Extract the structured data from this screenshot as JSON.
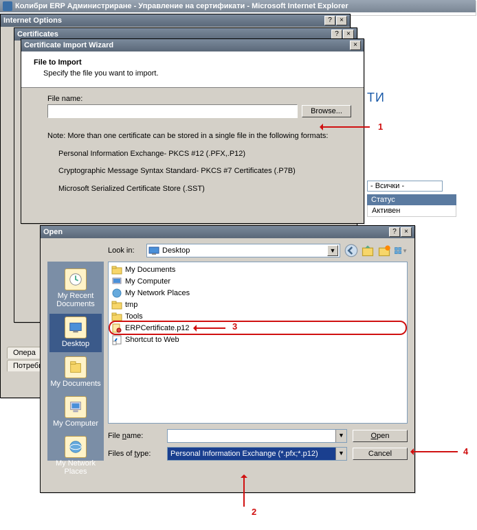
{
  "browser": {
    "title": "Колибри ERP Администриране - Управление на сертификати - Microsoft Internet Explorer"
  },
  "internet_options": {
    "title": "Internet Options",
    "help": "?",
    "close": "×"
  },
  "certificates": {
    "title": "Certificates",
    "help": "?",
    "close": "×"
  },
  "wizard": {
    "title": "Certificate Import Wizard",
    "close": "×",
    "header": "File to Import",
    "subheader": "Specify the file you want to import.",
    "filename_label": "File name:",
    "filename_value": "",
    "browse": "Browse...",
    "note_intro": "Note:  More than one certificate can be stored in a single file in the following formats:",
    "note_items": [
      "Personal Information Exchange- PKCS #12 (.PFX,.P12)",
      "Cryptographic Message Syntax Standard- PKCS #7 Certificates (.P7B)",
      "Microsoft Serialized Certificate Store (.SST)"
    ]
  },
  "open": {
    "title": "Open",
    "help": "?",
    "close": "×",
    "lookin_label": "Look in:",
    "lookin_value": "Desktop",
    "places": [
      "My Recent Documents",
      "Desktop",
      "My Documents",
      "My Computer",
      "My Network Places"
    ],
    "places_selected": 1,
    "files": [
      {
        "name": "My Documents",
        "type": "folder"
      },
      {
        "name": "My Computer",
        "type": "computer"
      },
      {
        "name": "My Network Places",
        "type": "network"
      },
      {
        "name": "tmp",
        "type": "folder"
      },
      {
        "name": "Tools",
        "type": "folder"
      },
      {
        "name": "ERPCertificate.p12",
        "type": "cert",
        "selected": true
      },
      {
        "name": "Shortcut to Web",
        "type": "shortcut"
      }
    ],
    "filename_label": "File name:",
    "filename_value": "",
    "filetype_label": "Files of type:",
    "filetype_value": "Personal Information Exchange (*.pfx;*.p12)",
    "open_btn": "Open",
    "cancel_btn": "Cancel"
  },
  "bg": {
    "heading": "ТИ",
    "filter": "- Всички -",
    "status_hdr": "Статус",
    "status_val": "Активен",
    "tab1": "Опера",
    "tab2": "Потреби"
  },
  "ann": {
    "n1": "1",
    "n2": "2",
    "n3": "3",
    "n4": "4"
  }
}
